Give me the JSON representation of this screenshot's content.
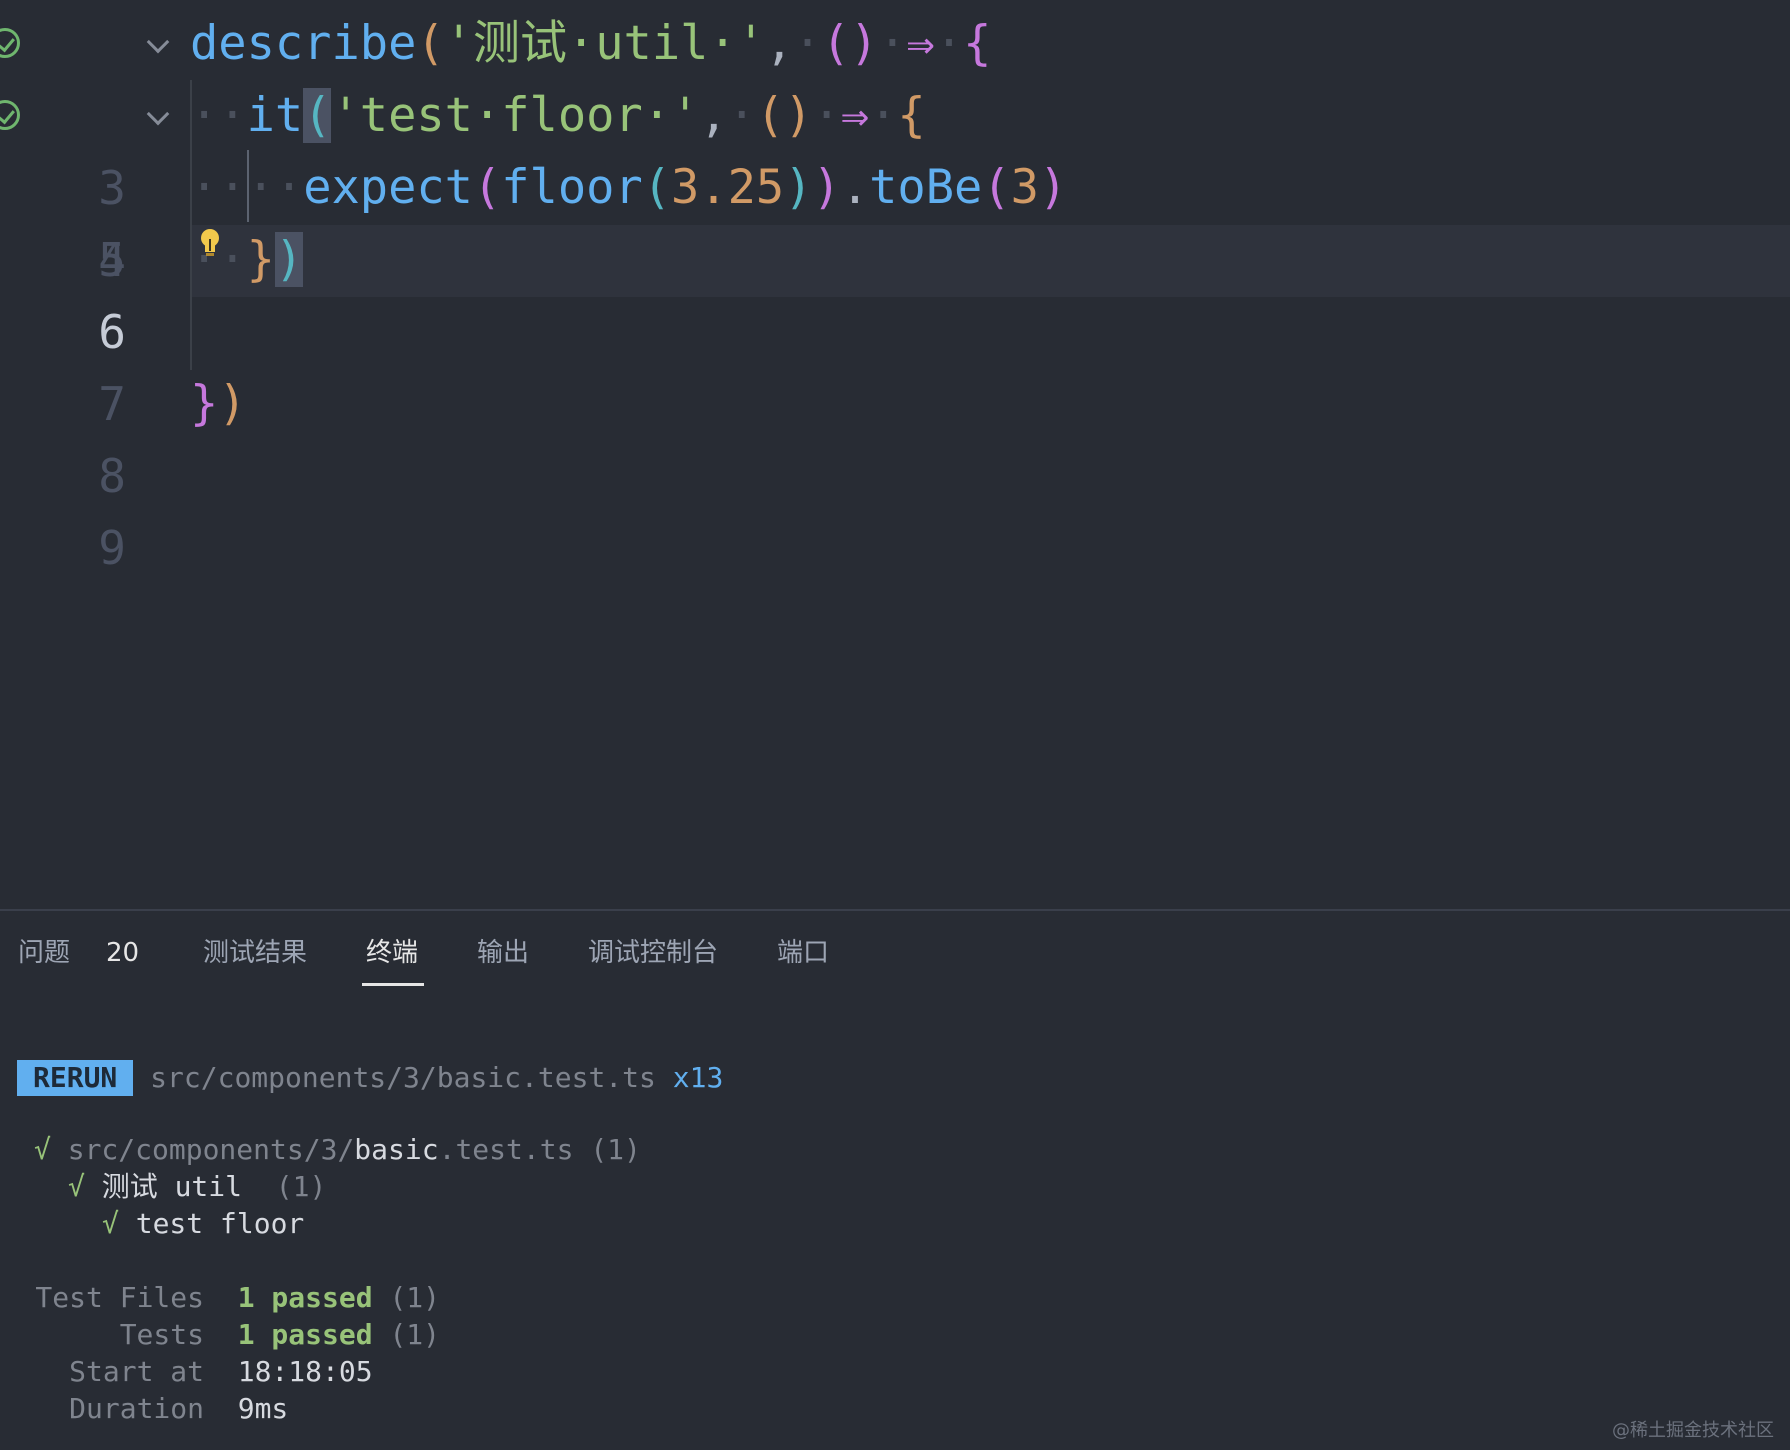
{
  "editor": {
    "lines": [
      {
        "num": "3",
        "active": false,
        "tested": true,
        "foldable": true
      },
      {
        "num": "4",
        "active": false,
        "tested": true,
        "foldable": true
      },
      {
        "num": "5",
        "active": false,
        "tested": false,
        "foldable": false
      },
      {
        "num": "6",
        "active": true,
        "tested": false,
        "foldable": false
      },
      {
        "num": "7",
        "active": false,
        "tested": false,
        "foldable": false
      },
      {
        "num": "8",
        "active": false,
        "tested": false,
        "foldable": false
      },
      {
        "num": "9",
        "active": false,
        "tested": false,
        "foldable": false
      }
    ],
    "code": {
      "l3_fn": "describe",
      "l3_str": "'测试·util·'",
      "l4_fn": "it",
      "l4_str": "'test·floor·'",
      "l5_fn1": "expect",
      "l5_fn2": "floor",
      "l5_num": "3.25",
      "l5_fn3": "toBe",
      "l5_num2": "3",
      "arrow": "⇒"
    }
  },
  "panel": {
    "tabs": [
      {
        "label": "问题",
        "badge": "20"
      },
      {
        "label": "测试结果"
      },
      {
        "label": "终端",
        "active": true
      },
      {
        "label": "输出"
      },
      {
        "label": "调试控制台"
      },
      {
        "label": "端口"
      }
    ],
    "terminal": {
      "rerun_label": "RERUN",
      "rerun_path": "src/components/3/basic.test.ts",
      "rerun_count": "x13",
      "file_check": "√",
      "file_dir": "src/components/3/",
      "file_name": "basic",
      "file_ext": ".test.ts",
      "file_count": "(1)",
      "suite_check": "√",
      "suite_name": "测试 util ",
      "suite_count": "(1)",
      "test_check": "√",
      "test_name": "test floor",
      "summary": [
        {
          "label": "Test Files",
          "value": "1 passed",
          "extra": "(1)"
        },
        {
          "label": "Tests",
          "value": "1 passed",
          "extra": "(1)"
        },
        {
          "label": "Start at",
          "value": "18:18:05",
          "extra": ""
        },
        {
          "label": "Duration",
          "value": "9ms",
          "extra": ""
        }
      ]
    }
  },
  "watermark": "@稀土掘金技术社区"
}
